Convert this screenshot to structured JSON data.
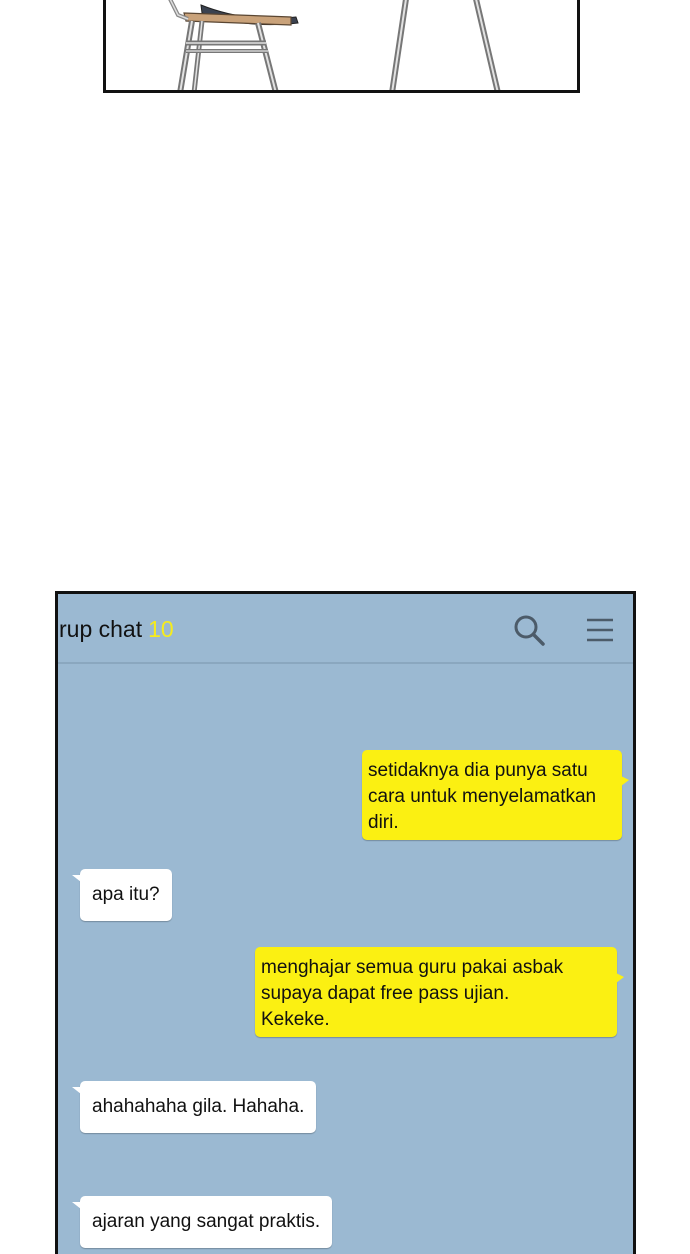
{
  "chat": {
    "title": "rup chat",
    "member_count": "10",
    "colors": {
      "background": "#9bb9d2",
      "outgoing_bubble": "#fbf012",
      "incoming_bubble": "#ffffff",
      "count": "#f6ec1d"
    },
    "icons": {
      "search": "search-icon",
      "menu": "menu-icon"
    },
    "messages": [
      {
        "side": "out",
        "text": "setidaknya dia punya satu\ncara untuk menyelamatkan\ndiri."
      },
      {
        "side": "in",
        "text": "apa itu?"
      },
      {
        "side": "out",
        "text": "menghajar semua guru pakai asbak\nsupaya dapat free pass ujian.\nKekeke."
      },
      {
        "side": "in",
        "text": "ahahahaha gila. Hahaha."
      },
      {
        "side": "in",
        "text": "ajaran yang sangat praktis."
      }
    ]
  }
}
